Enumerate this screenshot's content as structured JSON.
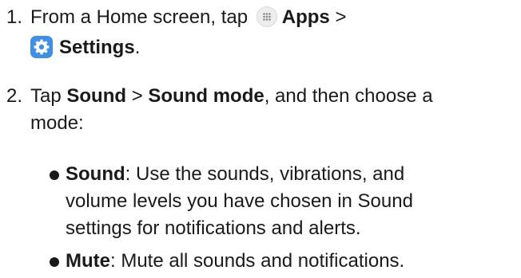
{
  "steps": [
    {
      "number": "1.",
      "text_a": "From a Home screen, tap",
      "apps_label": "Apps",
      "separator": ">",
      "settings_label": "Settings",
      "end": "."
    },
    {
      "number": "2.",
      "text_a": "Tap",
      "sound_label": "Sound",
      "separator": ">",
      "sound_mode_label": "Sound mode",
      "text_b": ", and then choose a",
      "text_c": "mode:"
    }
  ],
  "bullets": [
    {
      "term": "Sound",
      "line1": ": Use the sounds, vibrations, and",
      "line2": "volume levels you have chosen in Sound",
      "line3": "settings for notifications and alerts."
    },
    {
      "term": "Mute",
      "line1": ": Mute all sounds and notifications."
    }
  ],
  "icons": {
    "apps": "apps-grid-icon",
    "settings": "settings-gear-icon",
    "settings_color": "#3d8fe8"
  }
}
